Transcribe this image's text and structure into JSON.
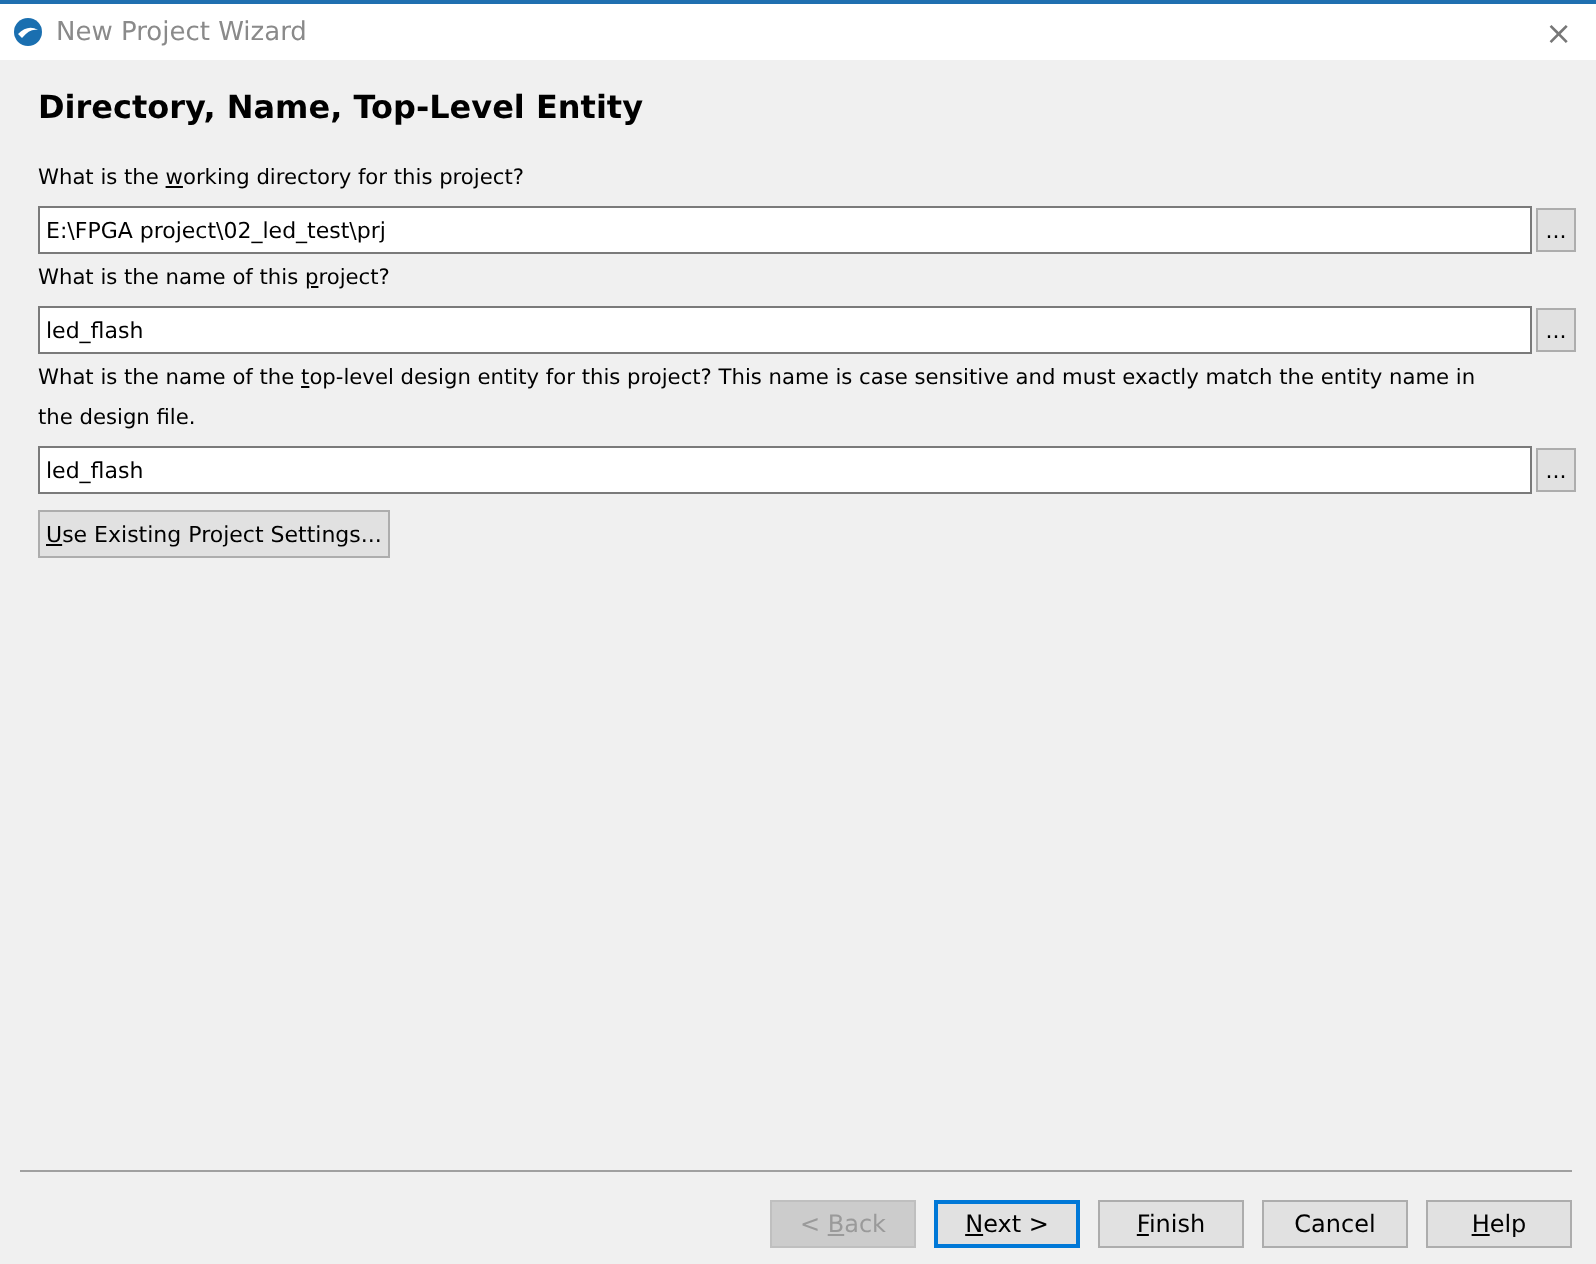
{
  "window": {
    "title": "New Project Wizard",
    "close": "×"
  },
  "page_title": "Directory, Name, Top-Level Entity",
  "fields": [
    {
      "label": {
        "pre": "What is the ",
        "key": "w",
        "post": "orking directory for this project?"
      },
      "value": "E:\\FPGA project\\02_led_test\\prj",
      "browse": "..."
    },
    {
      "label": {
        "pre": "What is the name of this ",
        "key": "p",
        "post": "roject?"
      },
      "value": "led_flash",
      "browse": "..."
    },
    {
      "label": {
        "pre": "What is the name of the ",
        "key": "t",
        "post": "op-level design entity for this project? This name is case sensitive and must exactly match the entity name in the design file."
      },
      "value": "led_flash",
      "browse": "..."
    }
  ],
  "settings_button": {
    "label": {
      "key": "U",
      "post": "se Existing Project Settings..."
    }
  },
  "buttons": [
    {
      "label": {
        "pre": "< ",
        "key": "B",
        "post": "ack"
      },
      "disabled": true,
      "default": false
    },
    {
      "label": {
        "key": "N",
        "post": "ext >"
      },
      "disabled": false,
      "default": true
    },
    {
      "label": {
        "key": "F",
        "post": "inish"
      },
      "disabled": false,
      "default": false
    },
    {
      "label": {
        "pre": "Cancel"
      },
      "disabled": false,
      "default": false
    },
    {
      "label": {
        "key": "H",
        "post": "elp"
      },
      "disabled": false,
      "default": false
    }
  ]
}
